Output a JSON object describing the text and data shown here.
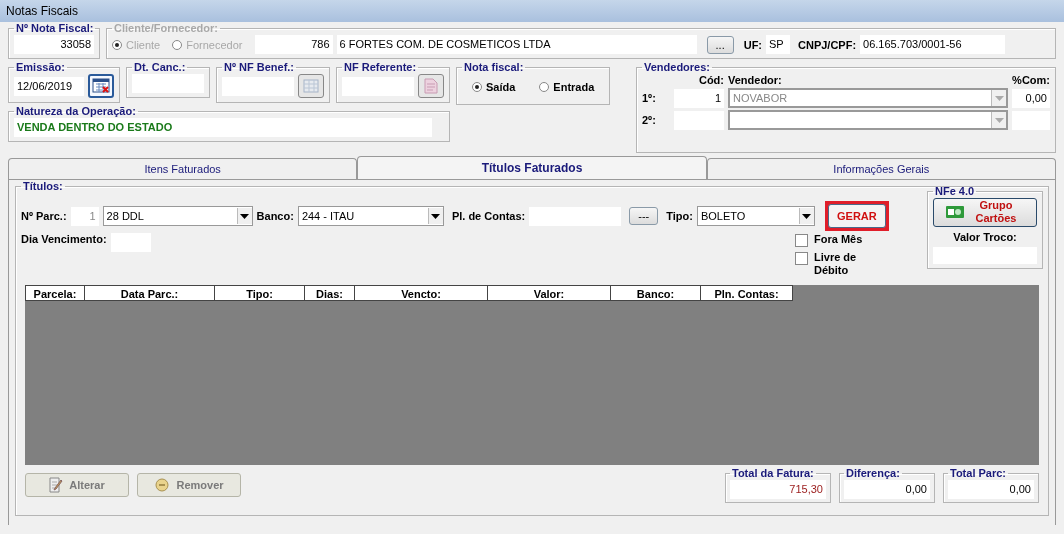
{
  "window": {
    "title": "Notas Fiscais"
  },
  "nota_fiscal": {
    "label": "Nº Nota Fiscal:",
    "value": "33058"
  },
  "cliente_fornecedor": {
    "label": "Cliente/Fornecedor:",
    "disabled": true,
    "options": [
      {
        "label": "Cliente",
        "selected": true
      },
      {
        "label": "Fornecedor",
        "selected": false
      }
    ],
    "code": "786",
    "name": "6 FORTES COM. DE COSMETICOS LTDA",
    "lookup_button": "...",
    "uf_label": "UF:",
    "uf": "SP",
    "cnpj_label": "CNPJ/CPF:",
    "cnpj": "06.165.703/0001-56"
  },
  "emissao": {
    "label": "Emissão:",
    "value": "12/06/2019"
  },
  "dt_canc": {
    "label": "Dt. Canc.:"
  },
  "nf_benef": {
    "label": "Nº NF Benef.:",
    "disabled": true
  },
  "nf_referente": {
    "label": "NF Referente:",
    "disabled": true
  },
  "nota_tipo": {
    "label": "Nota fiscal:",
    "options": [
      {
        "label": "Saída",
        "selected": true
      },
      {
        "label": "Entrada",
        "selected": false
      }
    ]
  },
  "vendedores": {
    "label": "Vendedores:",
    "code_header": "Cód:",
    "name_header": "Vendedor:",
    "commission_header": "%Com:",
    "rows": [
      {
        "label": "1º:",
        "code": "1",
        "name": "NOVABOR",
        "commission": "0,00"
      },
      {
        "label": "2º:"
      }
    ]
  },
  "natureza": {
    "label": "Natureza da Operação:",
    "value": "VENDA DENTRO DO ESTADO"
  },
  "tabs": [
    {
      "label": "Itens Faturados",
      "selected": false
    },
    {
      "label": "Títulos Faturados",
      "selected": true
    },
    {
      "label": "Informações Gerais",
      "selected": false
    }
  ],
  "titulos": {
    "label": "Títulos:",
    "parc_label": "Nº Parc.:",
    "parc": "1",
    "condicao": "28 DDL",
    "banco_label": "Banco:",
    "banco": "244 - ITAU",
    "plano_label": "Pl. de Contas:",
    "plano_button": "---",
    "tipo_label": "Tipo:",
    "tipo": "BOLETO",
    "gerar": {
      "label": "GERAR",
      "highlighted": true
    },
    "vencimento_label": "Dia Vencimento:",
    "checks": [
      {
        "label": "Fora Mês",
        "checked": false
      },
      {
        "label": "Livre de Débito",
        "checked": false
      }
    ]
  },
  "nfe": {
    "label": "NFe 4.0",
    "button": "Grupo Cartões",
    "troco_label": "Valor Troco:"
  },
  "table": {
    "columns": [
      "Parcela:",
      "Data Parc.:",
      "Tipo:",
      "Dias:",
      "Vencto:",
      "Valor:",
      "Banco:",
      "Pln. Contas:"
    ]
  },
  "actions": [
    {
      "label": "Alterar",
      "kind": "edit",
      "disabled": true
    },
    {
      "label": "Remover",
      "kind": "remove",
      "disabled": true
    }
  ],
  "totals": [
    {
      "label": "Total da Fatura:",
      "value": "715,30",
      "highlighted": true
    },
    {
      "label": "Diferença:",
      "value": "0,00",
      "highlighted": false
    },
    {
      "label": "Total Parc:",
      "value": "0,00",
      "highlighted": false
    }
  ]
}
